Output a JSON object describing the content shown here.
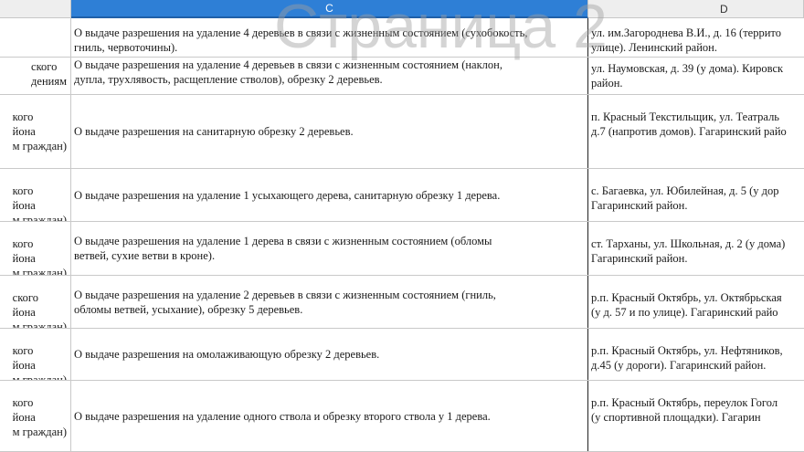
{
  "columns": {
    "b": "",
    "c": "C",
    "d": "D"
  },
  "watermark": "Страница 2",
  "rows": [
    {
      "b": [
        "",
        ""
      ],
      "c": [
        "О выдаче разрешения на удаление 4 деревьев в связи с жизненным состоянием (сухобокость,",
        "гниль, червоточины)."
      ],
      "d": [
        "ул. им.Загороднева В.И., д. 16 (террито",
        "улице). Ленинский район."
      ]
    },
    {
      "b": [
        "ского",
        "дениям"
      ],
      "c": [
        "О выдаче разрешения на удаление 4 деревьев в связи с жизненным состоянием (наклон,",
        "дупла, трухлявость, расщепление стволов), обрезку 2 деревьев."
      ],
      "d": [
        "ул. Наумовская, д. 39 (у дома). Кировск",
        "район."
      ]
    },
    {
      "b": [
        "кого",
        "йона",
        "м граждан)"
      ],
      "c": [
        "О выдаче разрешения на санитарную обрезку 2 деревьев."
      ],
      "d": [
        "п. Красный Текстильщик, ул. Театраль",
        "д.7 (напротив домов). Гагаринский райо"
      ]
    },
    {
      "b": [
        "кого",
        "йона",
        "м граждан)"
      ],
      "c": [
        "О выдаче разрешения на удаление 1 усыхающего дерева, санитарную обрезку 1 дерева."
      ],
      "d": [
        "с. Багаевка, ул. Юбилейная, д. 5 (у дор",
        "Гагаринский район."
      ]
    },
    {
      "b": [
        "кого",
        "йона",
        "м граждан)"
      ],
      "c": [
        "О выдаче разрешения на удаление 1 дерева в связи с жизненным состоянием (обломы",
        "ветвей, сухие ветви в кроне)."
      ],
      "d": [
        "ст. Тарханы, ул. Школьная, д. 2 (у дома)",
        "Гагаринский район."
      ]
    },
    {
      "b": [
        "ского",
        "йона",
        "м граждан)"
      ],
      "c": [
        "О выдаче разрешения на удаление 2 деревьев в связи с жизненным состоянием (гниль,",
        "обломы ветвей, усыхание), обрезку 5 деревьев."
      ],
      "d": [
        "р.п. Красный Октябрь, ул. Октябрьская",
        " (у д. 57 и по улице). Гагаринский райо"
      ]
    },
    {
      "b": [
        "кого",
        "йона",
        "м граждан)"
      ],
      "c": [
        "О выдаче разрешения на омолаживающую обрезку 2 деревьев."
      ],
      "d": [
        "р.п. Красный Октябрь, ул. Нефтяников,",
        "д.45 (у дороги). Гагаринский район."
      ]
    },
    {
      "b": [
        "кого",
        "йона",
        "м граждан)"
      ],
      "c": [
        "О выдаче разрешения на удаление одного ствола и обрезку второго ствола у 1 дерева."
      ],
      "d": [
        "р.п. Красный Октябрь, переулок Гогол",
        "        (у спортивной площадки). Гагарин"
      ]
    }
  ]
}
